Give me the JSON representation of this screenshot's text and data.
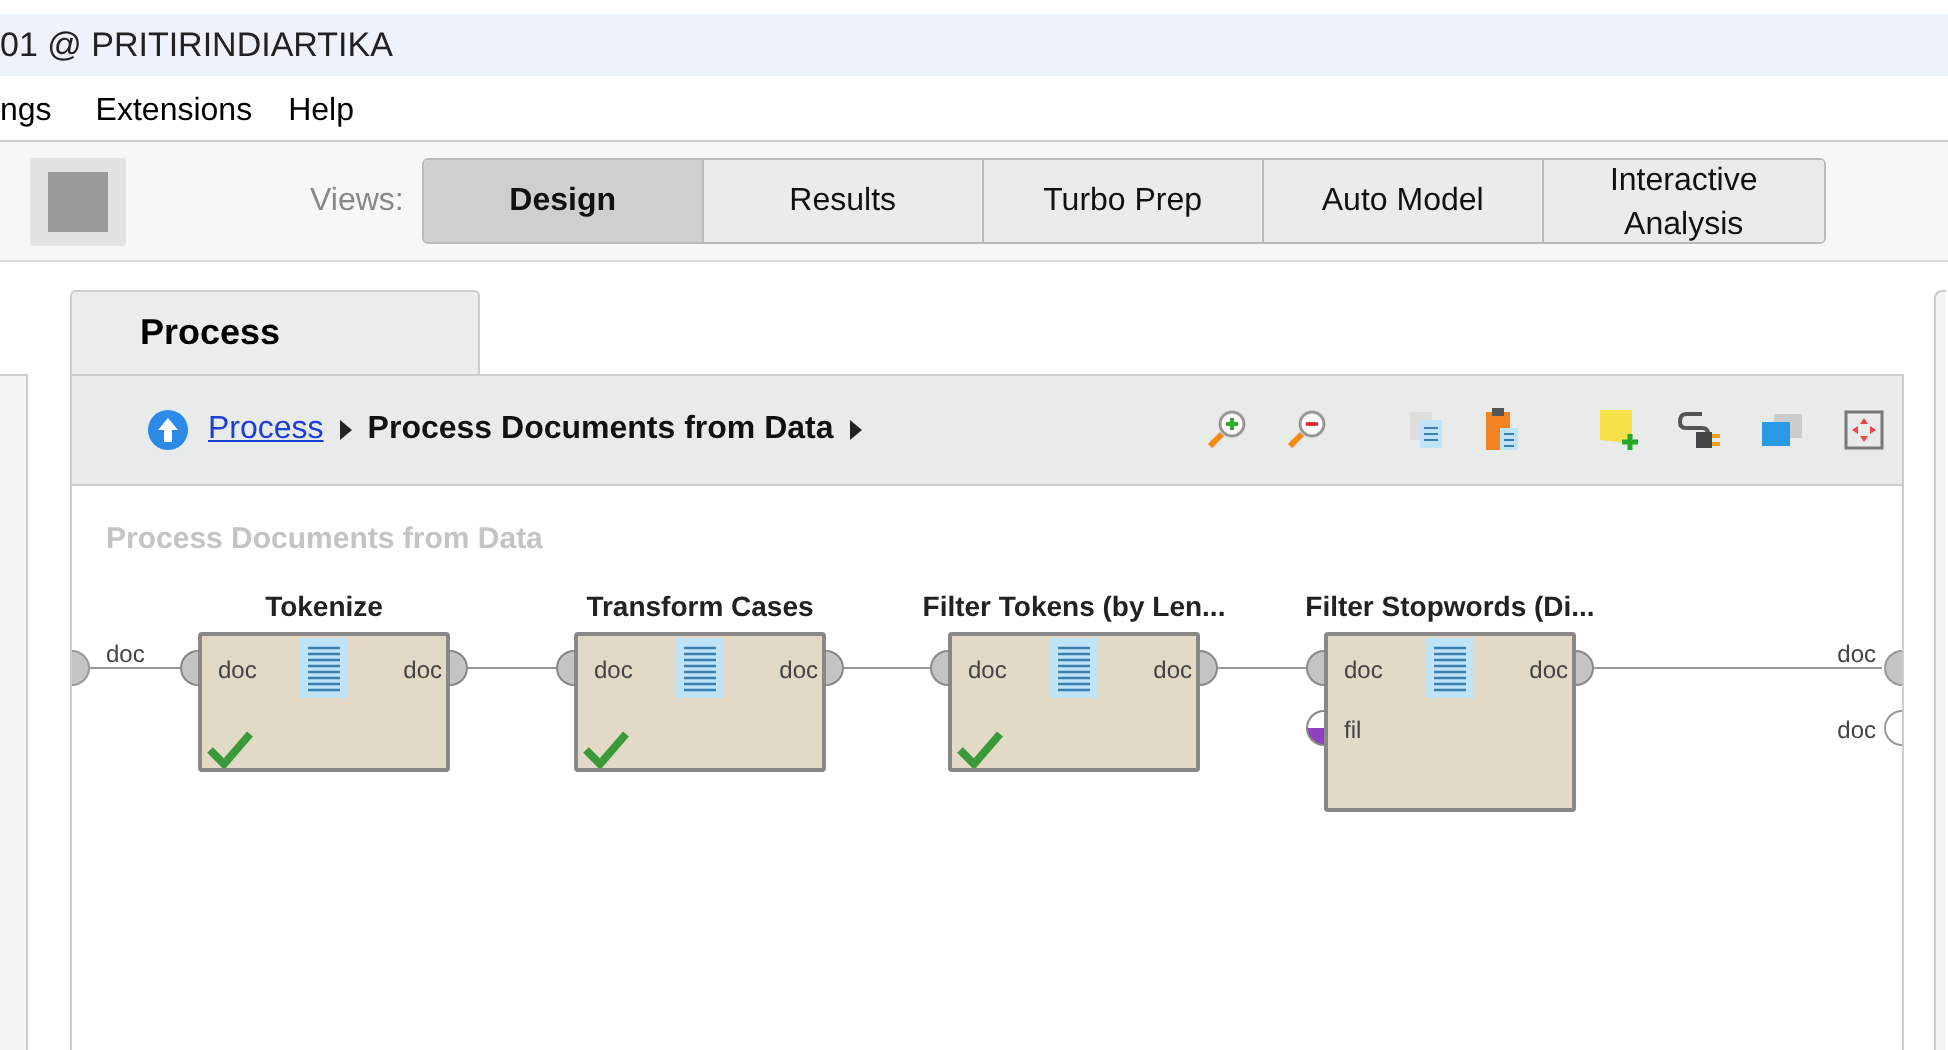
{
  "window": {
    "title": "01 @ PRITIRINDIARTIKA"
  },
  "menu": [
    "ngs",
    "Extensions",
    "Help"
  ],
  "views": {
    "label": "Views:",
    "tabs": [
      {
        "label": "Design",
        "selected": true
      },
      {
        "label": "Results",
        "selected": false
      },
      {
        "label": "Turbo Prep",
        "selected": false
      },
      {
        "label": "Auto Model",
        "selected": false
      },
      {
        "label": "Interactive Analysis",
        "selected": false
      }
    ]
  },
  "panel": {
    "tab": "Process",
    "breadcrumb": [
      {
        "label": "Process",
        "kind": "link"
      },
      {
        "label": "Process Documents from Data",
        "kind": "current"
      }
    ],
    "canvas_title": "Process Documents from Data",
    "process_inputs": [
      {
        "label": "doc"
      }
    ],
    "process_outputs": [
      {
        "label": "doc",
        "connected": true
      },
      {
        "label": "doc",
        "connected": false
      }
    ],
    "operators": [
      {
        "name": "Tokenize",
        "executed": true,
        "inputs": [
          {
            "label": "doc",
            "color": "#c4c4c4"
          }
        ],
        "outputs": [
          {
            "label": "doc"
          }
        ]
      },
      {
        "name": "Transform Cases",
        "executed": true,
        "inputs": [
          {
            "label": "doc",
            "color": "#c4c4c4"
          }
        ],
        "outputs": [
          {
            "label": "doc"
          }
        ]
      },
      {
        "name": "Filter Tokens (by Len...",
        "executed": true,
        "inputs": [
          {
            "label": "doc",
            "color": "#c4c4c4"
          }
        ],
        "outputs": [
          {
            "label": "doc"
          }
        ]
      },
      {
        "name": "Filter Stopwords (Di...",
        "executed": false,
        "inputs": [
          {
            "label": "doc",
            "color": "#c4c4c4"
          },
          {
            "label": "fil",
            "color": "#9040c0"
          }
        ],
        "outputs": [
          {
            "label": "doc"
          }
        ]
      }
    ]
  }
}
